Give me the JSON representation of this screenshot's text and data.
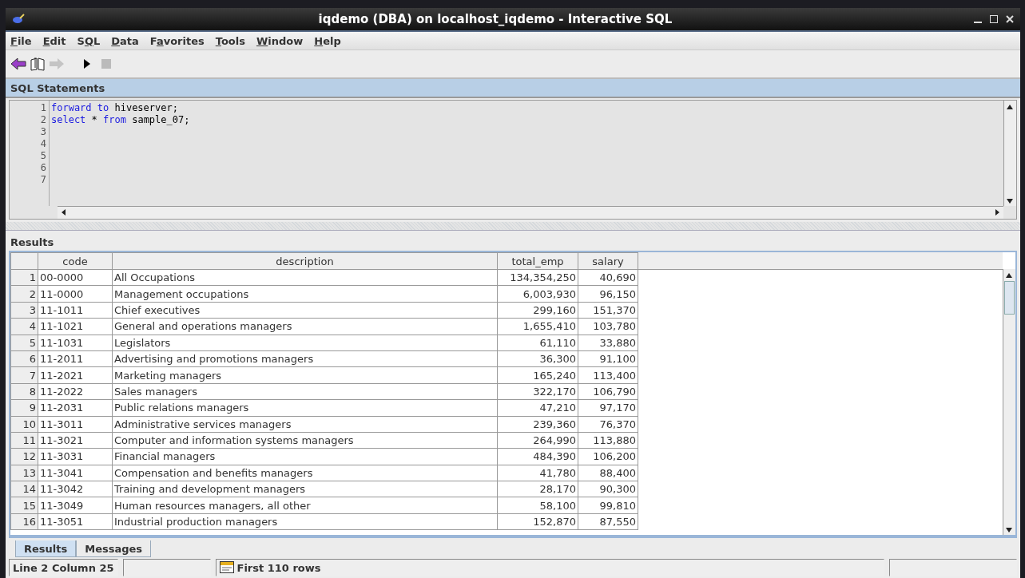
{
  "window": {
    "title": "iqdemo (DBA) on localhost_iqdemo - Interactive SQL"
  },
  "menu": [
    {
      "key": "F",
      "after": "ile"
    },
    {
      "key": "E",
      "after": "dit"
    },
    {
      "before": "S",
      "key": "Q",
      "after": "L"
    },
    {
      "key": "D",
      "after": "ata"
    },
    {
      "before": "F",
      "key": "a",
      "after": "vorites"
    },
    {
      "key": "T",
      "after": "ools"
    },
    {
      "key": "W",
      "after": "indow"
    },
    {
      "key": "H",
      "after": "elp"
    }
  ],
  "toolbar": [
    {
      "kind": "back",
      "disabled": false
    },
    {
      "kind": "book",
      "disabled": false
    },
    {
      "kind": "forward",
      "disabled": true
    },
    {
      "kind": "run",
      "disabled": false
    },
    {
      "kind": "stop",
      "disabled": true
    }
  ],
  "sql_panel": {
    "title": "SQL Statements",
    "line_numbers": [
      "1",
      "2",
      "3",
      "4",
      "5",
      "6",
      "7"
    ],
    "lines": [
      [
        {
          "text": "forward to",
          "kind": "keyword"
        },
        {
          "text": " hiveserver;",
          "kind": "plain"
        }
      ],
      [
        {
          "text": "select",
          "kind": "keyword"
        },
        {
          "text": " * ",
          "kind": "plain"
        },
        {
          "text": "from",
          "kind": "keyword"
        },
        {
          "text": " sample_07;",
          "kind": "plain"
        }
      ]
    ]
  },
  "results_panel": {
    "title": "Results",
    "columns": [
      "",
      "code",
      "description",
      "total_emp",
      "salary"
    ],
    "rows": [
      [
        "1",
        "00-0000",
        "All Occupations",
        "134,354,250",
        "40,690"
      ],
      [
        "2",
        "11-0000",
        "Management occupations",
        "6,003,930",
        "96,150"
      ],
      [
        "3",
        "11-1011",
        "Chief executives",
        "299,160",
        "151,370"
      ],
      [
        "4",
        "11-1021",
        "General and operations managers",
        "1,655,410",
        "103,780"
      ],
      [
        "5",
        "11-1031",
        "Legislators",
        "61,110",
        "33,880"
      ],
      [
        "6",
        "11-2011",
        "Advertising and promotions managers",
        "36,300",
        "91,100"
      ],
      [
        "7",
        "11-2021",
        "Marketing managers",
        "165,240",
        "113,400"
      ],
      [
        "8",
        "11-2022",
        "Sales managers",
        "322,170",
        "106,790"
      ],
      [
        "9",
        "11-2031",
        "Public relations managers",
        "47,210",
        "97,170"
      ],
      [
        "10",
        "11-3011",
        "Administrative services managers",
        "239,360",
        "76,370"
      ],
      [
        "11",
        "11-3021",
        "Computer and information systems managers",
        "264,990",
        "113,880"
      ],
      [
        "12",
        "11-3031",
        "Financial managers",
        "484,390",
        "106,200"
      ],
      [
        "13",
        "11-3041",
        "Compensation and benefits managers",
        "41,780",
        "88,400"
      ],
      [
        "14",
        "11-3042",
        "Training and development managers",
        "28,170",
        "90,300"
      ],
      [
        "15",
        "11-3049",
        "Human resources managers, all other",
        "58,100",
        "99,810"
      ],
      [
        "16",
        "11-3051",
        "Industrial production managers",
        "152,870",
        "87,550"
      ]
    ]
  },
  "bottom_tabs": [
    {
      "label": "Results",
      "selected": true
    },
    {
      "label": "Messages",
      "selected": false
    }
  ],
  "status_bar": {
    "position": "Line 2  Column 25",
    "rows_info": "First 110 rows"
  }
}
